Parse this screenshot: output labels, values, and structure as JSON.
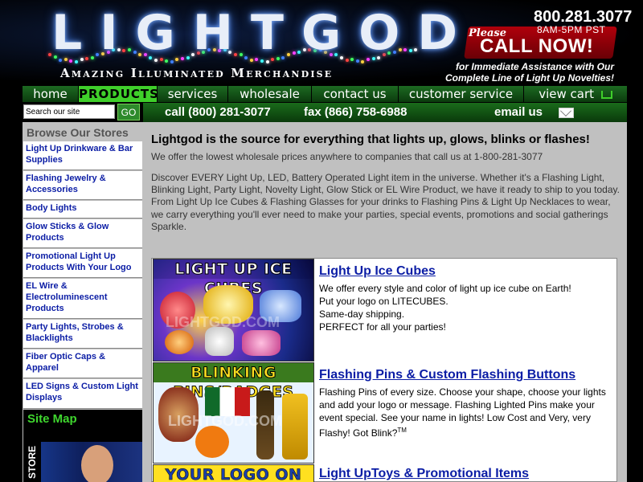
{
  "header": {
    "logo": "LIGHTGOD",
    "tagline": "Amazing Illuminated Merchandise",
    "phone": "800.281.3077",
    "hours": "8AM-5PM PST",
    "please": "Please",
    "call_now": "CALL NOW!",
    "assist_line1": "for Immediate Assistance with Our",
    "assist_line2": "Complete Line of Light Up Novelties!"
  },
  "nav": {
    "items": [
      "home",
      "PRODUCTS",
      "services",
      "wholesale",
      "contact us",
      "customer service",
      "view cart"
    ],
    "active": "PRODUCTS",
    "cart_icon": "shopping-cart-icon"
  },
  "search": {
    "placeholder": "Search our site",
    "button": "GO"
  },
  "contact_bar": {
    "call": "call (800) 281-3077",
    "fax": "fax (866) 758-6988",
    "email": "email us",
    "email_icon": "envelope-icon"
  },
  "sidebar": {
    "header": "Browse Our Stores",
    "items": [
      "Light Up Drinkware & Bar Supplies",
      "Flashing Jewelry & Accessories",
      "Body Lights",
      "Glow Sticks & Glow Products",
      "Promotional Light Up Products With Your Logo",
      "EL Wire & Electroluminescent Products",
      "Party Lights, Strobes & Blacklights",
      "Fiber Optic Caps & Apparel",
      "LED Signs & Custom Light Displays"
    ],
    "sitemap": "Site Map",
    "store_label": "STORE"
  },
  "main": {
    "headline": "Lightgod is the source for everything that lights up, glows, blinks or flashes!",
    "subline": "We offer the lowest wholesale prices anywhere to companies that call us at 1-800-281-3077",
    "intro": "Discover EVERY Light Up, LED, Battery Operated Light item in the universe. Whether it's a Flashing Light, Blinking Light, Party Light, Novelty Light, Glow Stick or EL Wire Product, we have it ready to ship to you today. From Light Up Ice Cubes & Flashing Glasses for your drinks to Flashing Pins & Light Up Necklaces to wear, we carry everything you'll ever need to make your parties, special events, promotions and social gatherings Sparkle."
  },
  "products": [
    {
      "banner": "LIGHT UP ICE CUBES",
      "title": "Light Up Ice Cubes",
      "lines": [
        "We offer every style and color of light up ice cube on Earth!",
        "Put your logo on LITECUBES.",
        "Same-day shipping.",
        "PERFECT for all your parties!"
      ],
      "watermark": "LIGHTGOD.COM"
    },
    {
      "banner": "BLINKING PINS/BADGES",
      "title": "Flashing Pins & Custom Flashing Buttons",
      "desc": "Flashing Pins of every size. Choose your shape, choose your lights and add your logo or message. Flashing Lighted Pins make your event special. See your name in lights! Low Cost and Very, very Flashy! Got Blink?",
      "tm": "TM",
      "watermark": "LIGHTGOD.COM"
    },
    {
      "banner": "YOUR LOGO ON LIGHTS",
      "title": "Light UpToys & Promotional Items"
    }
  ],
  "colors": {
    "nav_green": "#1d6a22",
    "active_green": "#3fcf2a",
    "link_blue": "#0b1da5",
    "call_red": "#b0000b",
    "sitemap_green": "#3fd62e",
    "panel_gray": "#c0c0c0"
  }
}
